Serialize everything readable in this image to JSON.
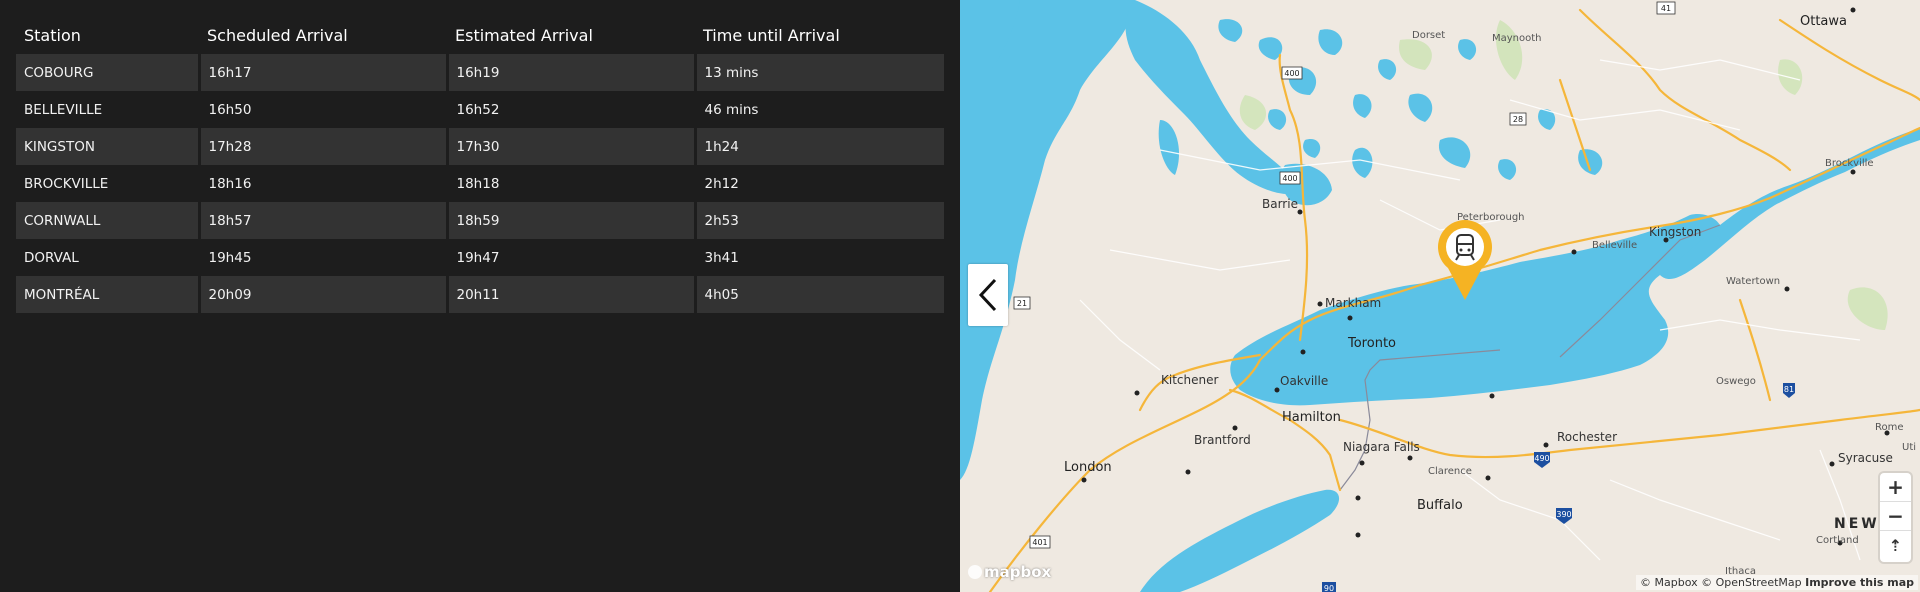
{
  "schedule": {
    "headers": [
      "Station",
      "Scheduled Arrival",
      "Estimated Arrival",
      "Time until Arrival"
    ],
    "rows": [
      [
        "COBOURG",
        "16h17",
        "16h19",
        "13 mins"
      ],
      [
        "BELLEVILLE",
        "16h50",
        "16h52",
        "46 mins"
      ],
      [
        "KINGSTON",
        "17h28",
        "17h30",
        "1h24"
      ],
      [
        "BROCKVILLE",
        "18h16",
        "18h18",
        "2h12"
      ],
      [
        "CORNWALL",
        "18h57",
        "18h59",
        "2h53"
      ],
      [
        "DORVAL",
        "19h45",
        "19h47",
        "3h41"
      ],
      [
        "MONTRÉAL",
        "20h09",
        "20h11",
        "4h05"
      ]
    ]
  },
  "map": {
    "labels": {
      "ottawa": "Ottawa",
      "dorset": "Dorset",
      "maynooth": "Maynooth",
      "barrie": "Barrie",
      "peterborough": "Peterborough",
      "belleville": "Belleville",
      "kingston": "Kingston",
      "brockville": "Brockville",
      "watertown": "Watertown",
      "markham": "Markham",
      "toronto": "Toronto",
      "kitchener": "Kitchener",
      "oakville": "Oakville",
      "hamilton": "Hamilton",
      "oswego": "Oswego",
      "rochester": "Rochester",
      "rome": "Rome",
      "uti": "Uti",
      "brantford": "Brantford",
      "niagara_falls": "Niagara Falls",
      "clarence": "Clarence",
      "syracuse": "Syracuse",
      "london": "London",
      "buffalo": "Buffalo",
      "cortland": "Cortland",
      "ithaca": "Ithaca",
      "new_york": "NEW R"
    },
    "shields": [
      "41",
      "400",
      "28",
      "400",
      "21",
      "401",
      "490",
      "390",
      "81",
      "90"
    ],
    "zoom_in": "+",
    "zoom_out": "−",
    "compass": "⇡",
    "attribution": "© Mapbox © OpenStreetMap",
    "improve": "Improve this map",
    "logo": "mapbox"
  },
  "colors": {
    "panel_bg": "#1d1d1d",
    "row_bg": "#333333",
    "water": "#5bc2e7",
    "land": "#efe9e1",
    "highway": "#f5b63a",
    "marker": "#f5b323"
  }
}
